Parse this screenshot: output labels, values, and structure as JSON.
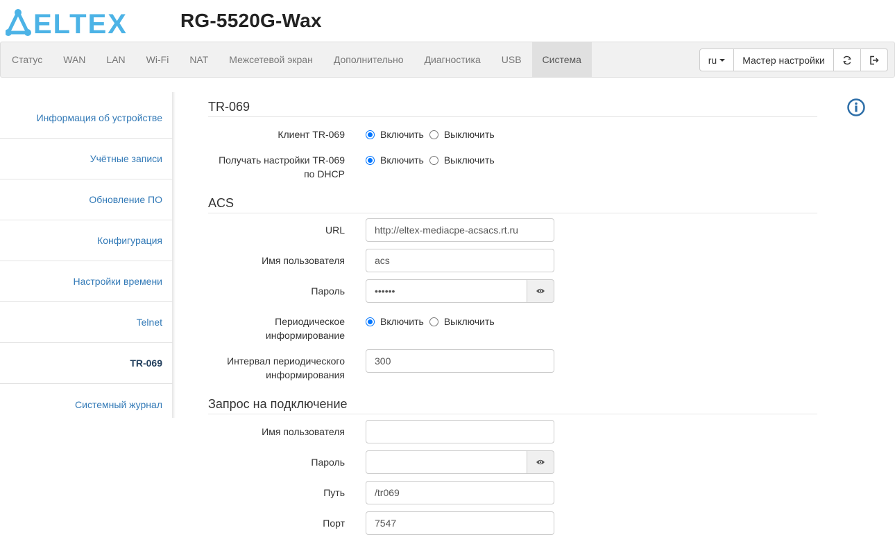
{
  "header": {
    "brand": "ELTEX",
    "device_title": "RG-5520G-Wax"
  },
  "navbar": {
    "items": [
      {
        "label": "Статус"
      },
      {
        "label": "WAN"
      },
      {
        "label": "LAN"
      },
      {
        "label": "Wi-Fi"
      },
      {
        "label": "NAT"
      },
      {
        "label": "Межсетевой экран"
      },
      {
        "label": "Дополнительно"
      },
      {
        "label": "Диагностика"
      },
      {
        "label": "USB"
      },
      {
        "label": "Система"
      }
    ],
    "active_item": "Система",
    "lang_label": "ru",
    "wizard_label": "Мастер настройки",
    "refresh_icon": "refresh-icon",
    "logout_icon": "logout-icon"
  },
  "sidebar": {
    "items": [
      {
        "label": "Информация об устройстве"
      },
      {
        "label": "Учётные записи"
      },
      {
        "label": "Обновление ПО"
      },
      {
        "label": "Конфигурация"
      },
      {
        "label": "Настройки времени"
      },
      {
        "label": "Telnet"
      },
      {
        "label": "TR-069"
      },
      {
        "label": "Системный журнал"
      }
    ],
    "active_item": "TR-069"
  },
  "tr069": {
    "title": "TR-069",
    "client": {
      "label": "Клиент TR-069",
      "on": "Включить",
      "off": "Выключить",
      "value": "on"
    },
    "dhcp": {
      "label_line1": "Получать настройки TR-069",
      "label_line2": "по DHCP",
      "on": "Включить",
      "off": "Выключить",
      "value": "on"
    }
  },
  "acs": {
    "title": "ACS",
    "url": {
      "label": "URL",
      "value": "http://eltex-mediacpe-acsacs.rt.ru"
    },
    "username": {
      "label": "Имя пользователя",
      "value": "acs"
    },
    "password": {
      "label": "Пароль",
      "value": "••••••"
    },
    "periodic": {
      "label_line1": "Периодическое",
      "label_line2": "информирование",
      "on": "Включить",
      "off": "Выключить",
      "value": "on"
    },
    "interval": {
      "label_line1": "Интервал периодического",
      "label_line2": "информирования",
      "value": "300"
    }
  },
  "conn_request": {
    "title": "Запрос на подключение",
    "username": {
      "label": "Имя пользователя",
      "value": ""
    },
    "password": {
      "label": "Пароль",
      "value": ""
    },
    "path": {
      "label": "Путь",
      "value": "/tr069"
    },
    "port": {
      "label": "Порт",
      "value": "7547"
    }
  },
  "colors": {
    "brand": "#4cb3e6",
    "link": "#337ab7",
    "info": "#2d6ea8",
    "radio": "#0075ff"
  }
}
